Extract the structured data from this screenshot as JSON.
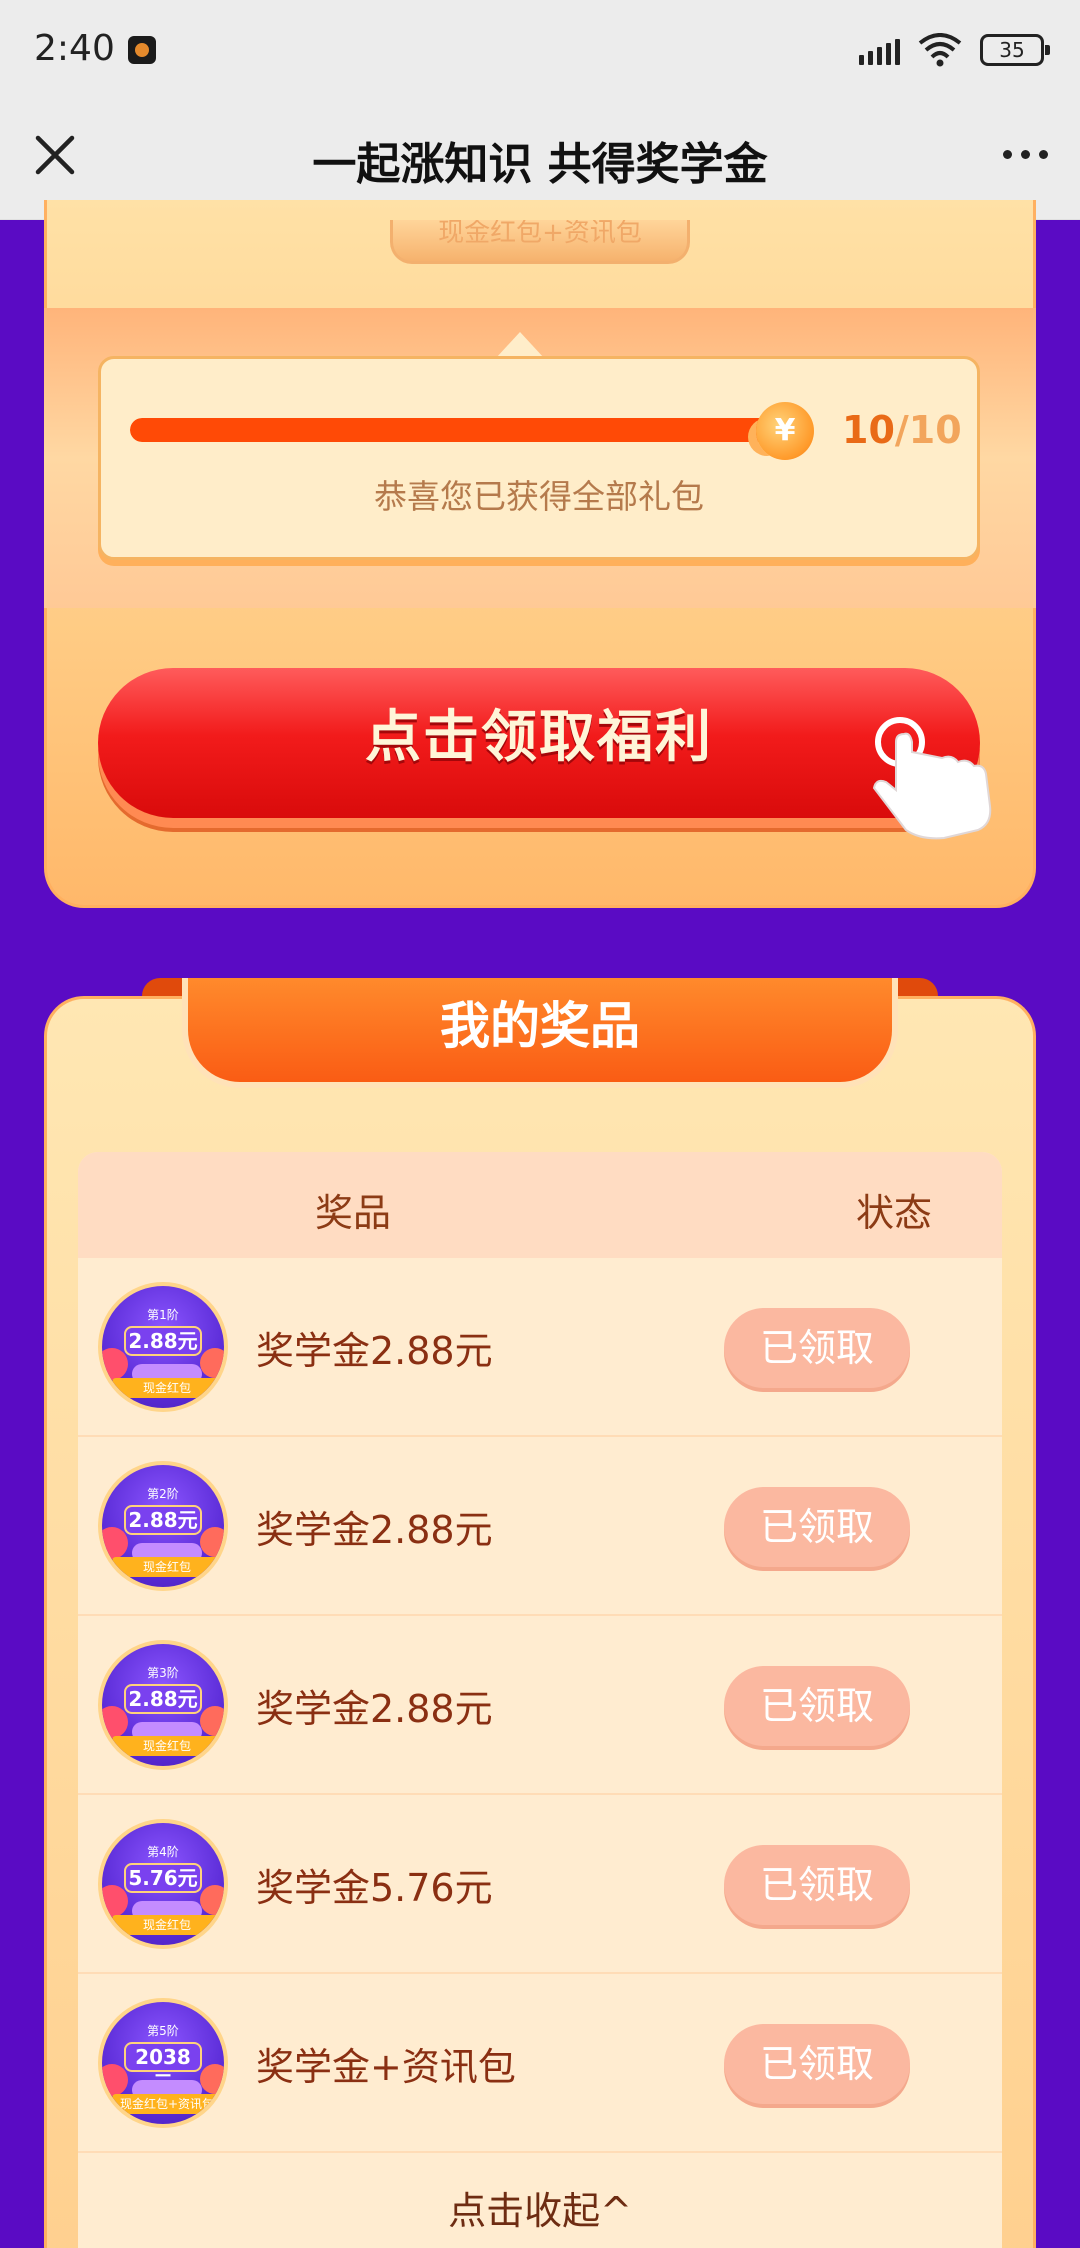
{
  "status_bar": {
    "time": "2:40",
    "battery": "35"
  },
  "title_bar": {
    "title": "一起涨知识 共得奖学金"
  },
  "top_card": {
    "tag_text": "现金红包+资讯包",
    "progress": {
      "current": "10",
      "total": "/10",
      "fraction": 1.0,
      "message": "恭喜您已获得全部礼包",
      "coin_symbol": "¥"
    },
    "claim_button_label": "点击领取福利"
  },
  "prizes_section": {
    "title": "我的奖品",
    "columns": {
      "prize": "奖品",
      "status": "状态"
    },
    "rows": [
      {
        "thumb_level": "第1阶",
        "thumb_amount": "2.88元",
        "thumb_label": "现金红包",
        "name": "奖学金2.88元",
        "status": "已领取"
      },
      {
        "thumb_level": "第2阶",
        "thumb_amount": "2.88元",
        "thumb_label": "现金红包",
        "name": "奖学金2.88元",
        "status": "已领取"
      },
      {
        "thumb_level": "第3阶",
        "thumb_amount": "2.88元",
        "thumb_label": "现金红包",
        "name": "奖学金2.88元",
        "status": "已领取"
      },
      {
        "thumb_level": "第4阶",
        "thumb_amount": "5.76元",
        "thumb_label": "现金红包",
        "name": "奖学金5.76元",
        "status": "已领取"
      },
      {
        "thumb_level": "第5阶",
        "thumb_amount": "2038元",
        "thumb_label": "现金红包+资讯包",
        "name": "奖学金+资讯包",
        "status": "已领取"
      }
    ],
    "collapse_label": "点击收起^"
  }
}
